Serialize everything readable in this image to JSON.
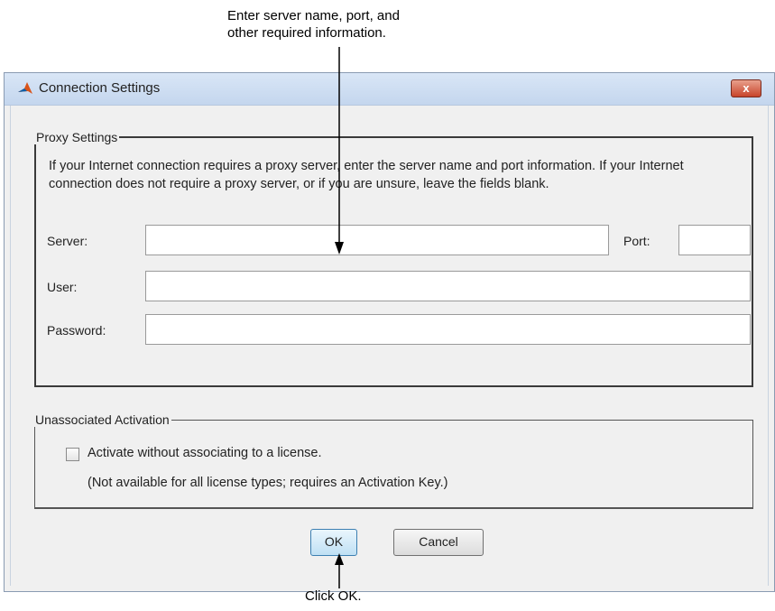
{
  "annotations": {
    "top_line1": "Enter server name, port, and",
    "top_line2": "other required information.",
    "bottom": "Click OK."
  },
  "window": {
    "title": "Connection Settings",
    "app_icon": "matlab-logo-icon",
    "close_label": "x"
  },
  "proxy": {
    "legend": "Proxy Settings",
    "description": "If your Internet connection requires a proxy server, enter the server name and port information. If your Internet connection does not require a proxy server, or if you are unsure, leave the fields blank.",
    "server_label": "Server:",
    "server_value": "",
    "port_label": "Port:",
    "port_value": "",
    "user_label": "User:",
    "user_value": "",
    "password_label": "Password:",
    "password_value": ""
  },
  "activation": {
    "legend": "Unassociated Activation",
    "checkbox_label": "Activate without associating to a license.",
    "checkbox_checked": false,
    "note": "(Not available for all license types; requires an Activation Key.)"
  },
  "buttons": {
    "ok": "OK",
    "cancel": "Cancel"
  }
}
